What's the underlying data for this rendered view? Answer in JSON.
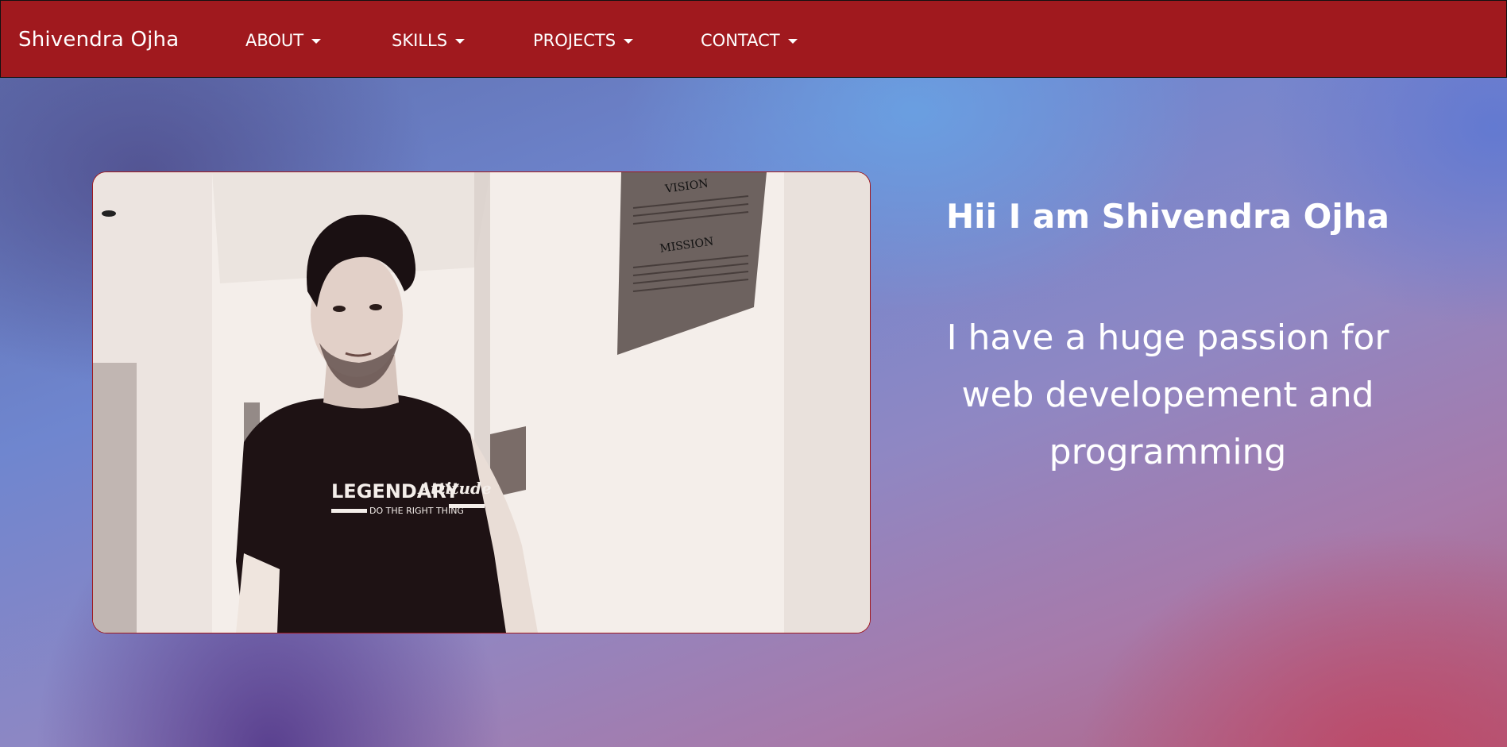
{
  "navbar": {
    "brand": "Shivendra Ojha",
    "items": [
      {
        "label": "ABOUT"
      },
      {
        "label": "SKILLS"
      },
      {
        "label": "PROJECTS"
      },
      {
        "label": "CONTACT"
      }
    ],
    "background_color": "#a0191e"
  },
  "hero": {
    "title": "Hii I am Shivendra Ojha",
    "subtitle": "I have a huge passion for web developement and programming",
    "photo": {
      "shirt_text_1": "LEGENDARY",
      "shirt_text_2": "Attitude",
      "shirt_text_3": "DO THE RIGHT THING",
      "board_heading_1": "VISION",
      "board_heading_2": "MISSION"
    }
  }
}
